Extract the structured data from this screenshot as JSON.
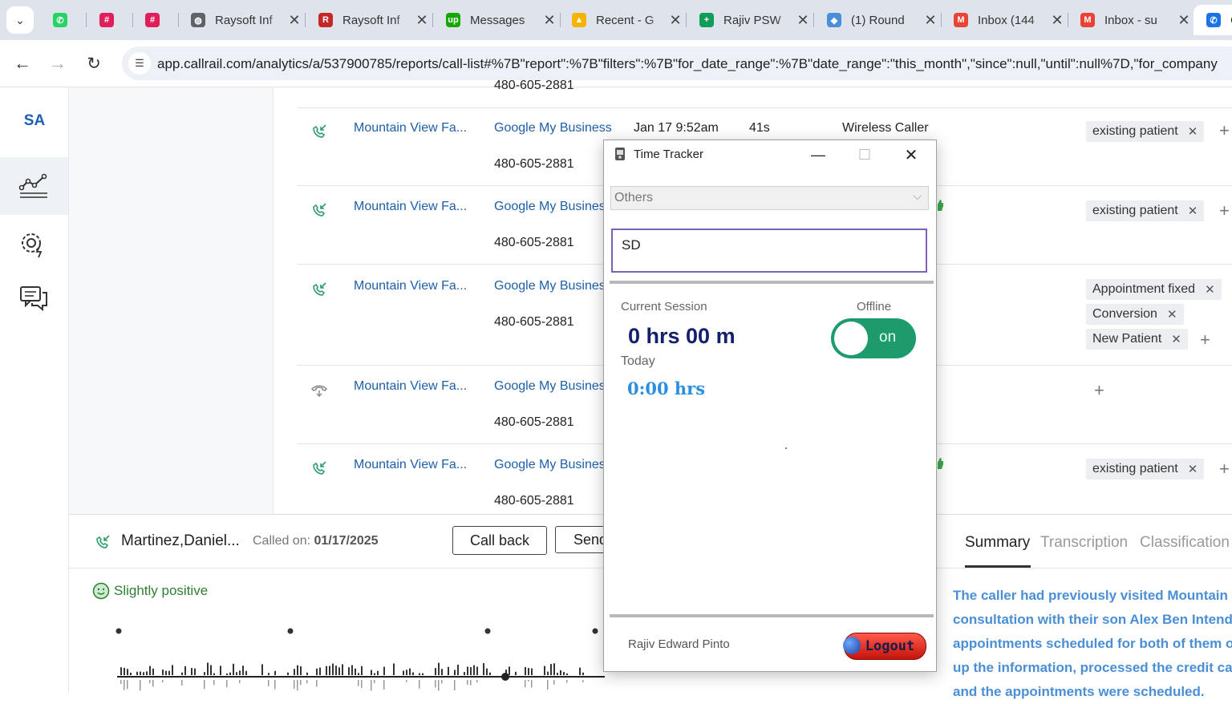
{
  "browser": {
    "tabs": [
      {
        "title": "",
        "icon": "whatsapp-icon",
        "color": "#25d366",
        "glyph": "✆"
      },
      {
        "title": "",
        "icon": "slack-icon",
        "color": "#e01e5a",
        "glyph": "#"
      },
      {
        "title": "",
        "icon": "slack-icon",
        "color": "#e01e5a",
        "glyph": "#"
      },
      {
        "title": "Raysoft Inf",
        "icon": "globe-icon",
        "color": "#5f6368",
        "glyph": "◍"
      },
      {
        "title": "Raysoft Inf",
        "icon": "raysoft-icon",
        "color": "#c62828",
        "glyph": "R"
      },
      {
        "title": "Messages",
        "icon": "upwork-icon",
        "color": "#14a800",
        "glyph": "up"
      },
      {
        "title": "Recent - G",
        "icon": "google-drive-icon",
        "color": "#f4b400",
        "glyph": "▲"
      },
      {
        "title": "Rajiv PSW",
        "icon": "google-sheets-icon",
        "color": "#0f9d58",
        "glyph": "+"
      },
      {
        "title": "(1) Round",
        "icon": "roundcube-icon",
        "color": "#4a90d9",
        "glyph": "◆"
      },
      {
        "title": "Inbox (144",
        "icon": "gmail-icon",
        "color": "#ea4335",
        "glyph": "M"
      },
      {
        "title": "Inbox - su",
        "icon": "gmail-icon",
        "color": "#ea4335",
        "glyph": "M"
      },
      {
        "title": "C",
        "icon": "callrail-icon",
        "color": "#1a73e8",
        "glyph": "✆"
      }
    ],
    "url": "app.callrail.com/analytics/a/537900785/reports/call-list#%7B\"report\":%7B\"filters\":%7B\"for_date_range\":%7B\"date_range\":\"this_month\",\"since\":null,\"until\":null%7D,\"for_company"
  },
  "app": {
    "nav_initials": "SA"
  },
  "calls": {
    "top_partial_phone": "480-605-2881",
    "rows": [
      {
        "name": "Mountain View Fa...",
        "source": "Google My Business",
        "phone": "480-605-2881",
        "date": "Jan 17 9:52am",
        "duration": "41s",
        "caller_type": "Wireless Caller",
        "tags": [
          "existing patient"
        ]
      },
      {
        "name": "Mountain View Fa...",
        "source": "Google My Business",
        "phone": "480-605-2881",
        "tags": [
          "existing patient"
        ]
      },
      {
        "name": "Mountain View Fa...",
        "source": "Google My Business",
        "phone": "480-605-2881",
        "tags": [
          "Appointment fixed",
          "Conversion",
          "New Patient"
        ]
      },
      {
        "name": "Mountain View Fa...",
        "source": "Google My Business",
        "phone": "480-605-2881",
        "tags": []
      },
      {
        "name": "Mountain View Fa...",
        "source": "Google My Business",
        "phone": "480-605-2881",
        "tags": [
          "existing patient"
        ]
      }
    ]
  },
  "detail": {
    "caller_name": "Martinez,Daniel...",
    "called_on_label": "Called on:",
    "called_on_date": "01/17/2025",
    "call_back": "Call back",
    "send": "Send",
    "sentiment": "Slightly positive",
    "tabs": [
      "Summary",
      "Transcription",
      "Classification"
    ],
    "summary_lines": [
      "The caller had previously visited Mountain View",
      "consultation with their son Alex Ben Intende. T",
      "appointments scheduled for both of them on M",
      "up the information, processed the credit card p",
      "and the appointments were scheduled."
    ]
  },
  "time_tracker": {
    "title": "Time Tracker",
    "project": "Others",
    "task": "SD",
    "current_session_label": "Current Session",
    "current_session_value": "0 hrs 00 m",
    "today_label": "Today",
    "today_value": "0:00 hrs",
    "status_label": "Offline",
    "toggle_text": "on",
    "user": "Rajiv Edward Pinto",
    "logout": "Logout"
  },
  "colors": {
    "link": "#1f5fa8",
    "toggle": "#1e9b6c",
    "summary": "#4a8fd6",
    "sentiment": "#2e7d32"
  }
}
